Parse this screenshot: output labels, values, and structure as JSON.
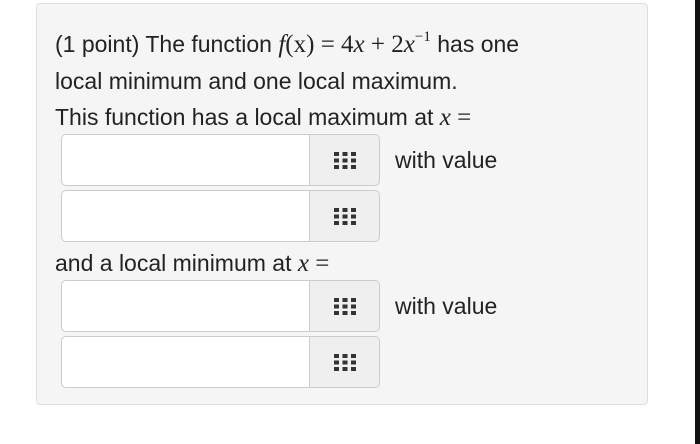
{
  "problem": {
    "prefix": "(1 point) The function",
    "suffix": "has one",
    "line2": "local minimum and one local maximum.",
    "line3": "This function has a local maximum at",
    "line4": "and a local minimum at",
    "with_value": "with value",
    "formula": {
      "fn": "f",
      "arg": "(x)",
      "eq": " = 4",
      "var": "x",
      "plus": " + 2",
      "exp": "−1"
    },
    "var": "x",
    "equals": " ="
  },
  "inputs": {
    "max_x": "",
    "max_value": "",
    "min_x": "",
    "min_value": ""
  },
  "colors": {
    "card_bg": "#f5f5f5",
    "card_border": "#dddddd",
    "input_border": "#cccccc",
    "button_bg": "#efefef",
    "icon": "#333333"
  },
  "icons": {
    "palette": "grid-icon"
  }
}
